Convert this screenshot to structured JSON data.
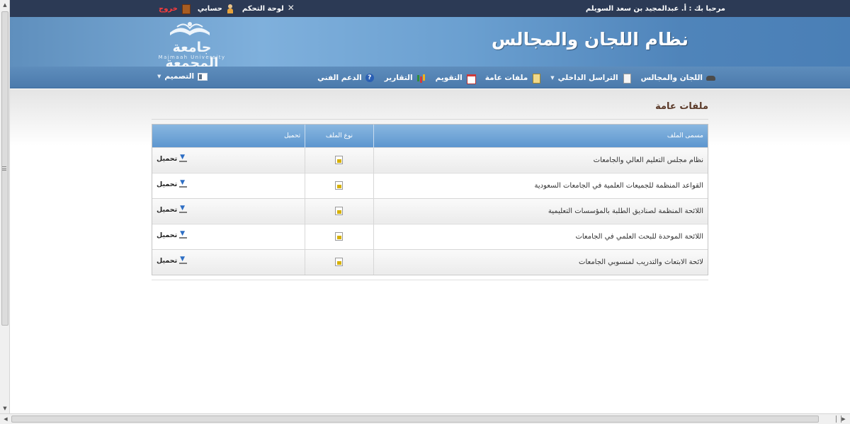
{
  "topbar": {
    "welcome": "مرحبا بك : أ. عبدالمجيد بن سعد السويلم",
    "links": {
      "control_panel": "لوحة التحكم",
      "my_account": "حسابي",
      "logout": "خروج"
    }
  },
  "banner": {
    "system_title": "نظام اللجان والمجالس",
    "logo_name": "جامعة المجمعة",
    "logo_sub": "Majmaah University"
  },
  "nav": {
    "items": [
      {
        "label": "اللجان والمجالس",
        "icon": "car-icon"
      },
      {
        "label": "التراسل الداخلي",
        "icon": "document-icon",
        "dropdown": true
      },
      {
        "label": "ملفات عامة",
        "icon": "clipboard-icon"
      },
      {
        "label": "التقويم",
        "icon": "calendar-icon"
      },
      {
        "label": "التقارير",
        "icon": "bar-chart-icon"
      },
      {
        "label": "الدعم الفني",
        "icon": "help-icon"
      }
    ],
    "design_label": "التصميم"
  },
  "page": {
    "heading": "ملفات عامة"
  },
  "table": {
    "headers": {
      "name": "مسمى الملف",
      "type": "نوع الملف",
      "download": "تحميل"
    },
    "rows": [
      {
        "name": "نظام مجلس التعليم العالي والجامعات",
        "download": "تحميل"
      },
      {
        "name": "القواعد المنظمة للجميعات العلمية في الجامعات السعودية",
        "download": "تحميل"
      },
      {
        "name": "اللائحة المنظمة لصناديق الطلبة بالمؤسسات التعليمية",
        "download": "تحميل"
      },
      {
        "name": "اللائحة الموحدة للبحث العلمي في الجامعات",
        "download": "تحميل"
      },
      {
        "name": "لائحة الابتعاث والتدريب لمنسوبي الجامعات",
        "download": "تحميل"
      }
    ]
  },
  "colors": {
    "topbar_bg": "#2c3a55",
    "banner_blue": "#6a9fd0",
    "nav_blue": "#4b7aac",
    "table_header": "#5d96cf",
    "logout_red": "#ff3b3b",
    "heading_brown": "#5b3a29"
  }
}
